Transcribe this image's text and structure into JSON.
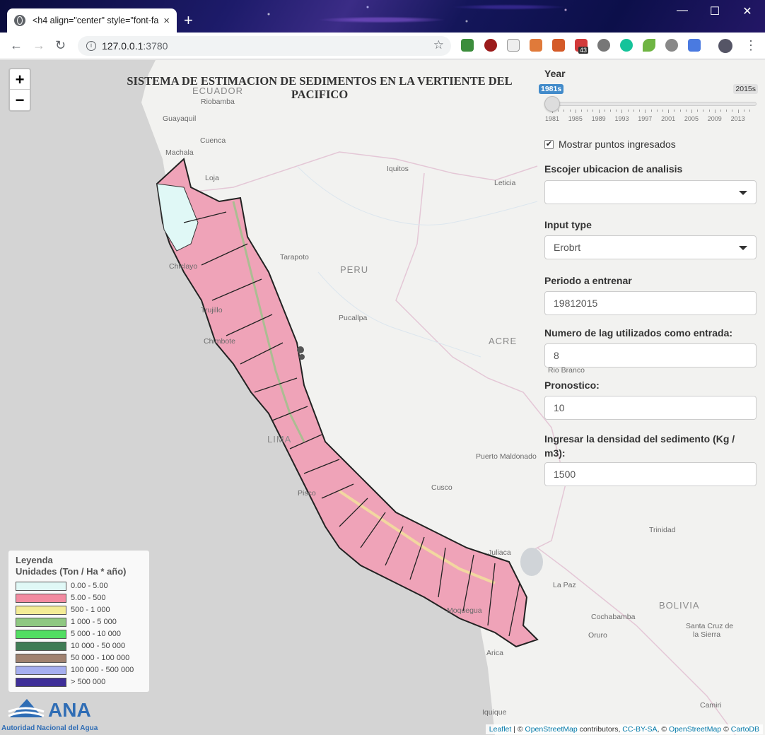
{
  "browser": {
    "tab_title": "<h4 align=\"center\" style=\"font-fa",
    "tab_close": "×",
    "new_tab": "+",
    "url_host": "127.0.0.1",
    "url_port": ":3780",
    "ext_badge": "43",
    "window": {
      "minimize": "—",
      "maximize": "☐",
      "close": "✕"
    }
  },
  "map": {
    "title_line1": "SISTEMA DE ESTIMACION DE SEDIMENTOS EN LA VERTIENTE DEL",
    "title_line2": "PACIFICO",
    "zoom_in": "+",
    "zoom_out": "−",
    "places": [
      {
        "name": "ECUADOR",
        "kind": "country"
      },
      {
        "name": "Riobamba",
        "kind": "city"
      },
      {
        "name": "Guayaquil",
        "kind": "city"
      },
      {
        "name": "Cuenca",
        "kind": "city"
      },
      {
        "name": "Machala",
        "kind": "city"
      },
      {
        "name": "Loja",
        "kind": "city"
      },
      {
        "name": "Iquitos",
        "kind": "city"
      },
      {
        "name": "Leticia",
        "kind": "city"
      },
      {
        "name": "Tarapoto",
        "kind": "city"
      },
      {
        "name": "PERU",
        "kind": "country"
      },
      {
        "name": "Chiclayo",
        "kind": "city"
      },
      {
        "name": "Trujillo",
        "kind": "city"
      },
      {
        "name": "Chimbote",
        "kind": "city"
      },
      {
        "name": "Pucallpa",
        "kind": "city"
      },
      {
        "name": "ACRE",
        "kind": "country"
      },
      {
        "name": "Rio Branco",
        "kind": "city"
      },
      {
        "name": "LIMA",
        "kind": "country"
      },
      {
        "name": "Puerto Maldonado",
        "kind": "city"
      },
      {
        "name": "Cusco",
        "kind": "city"
      },
      {
        "name": "Pisco",
        "kind": "city"
      },
      {
        "name": "Trinidad",
        "kind": "city"
      },
      {
        "name": "Juliaca",
        "kind": "city"
      },
      {
        "name": "La Paz",
        "kind": "city"
      },
      {
        "name": "BOLIVIA",
        "kind": "country"
      },
      {
        "name": "Cochabamba",
        "kind": "city"
      },
      {
        "name": "Santa Cruz de",
        "kind": "city"
      },
      {
        "name": "la Sierra",
        "kind": "city"
      },
      {
        "name": "Oruro",
        "kind": "city"
      },
      {
        "name": "Moquegua",
        "kind": "city"
      },
      {
        "name": "Arica",
        "kind": "city"
      },
      {
        "name": "Iquique",
        "kind": "city"
      },
      {
        "name": "Camiri",
        "kind": "city"
      }
    ]
  },
  "legend": {
    "title": "Leyenda",
    "subtitle": "Unidades (Ton / Ha * año)",
    "items": [
      {
        "label": "0.00 - 5.00",
        "color": "#e0f8f6"
      },
      {
        "label": "5.00 - 500",
        "color": "#f28aa0"
      },
      {
        "label": "500 - 1 000",
        "color": "#f4ec96"
      },
      {
        "label": "1 000 - 5 000",
        "color": "#8fc882"
      },
      {
        "label": "5 000 - 10 000",
        "color": "#52de62"
      },
      {
        "label": "10 000 - 50 000",
        "color": "#3f7c55"
      },
      {
        "label": "50 000 - 100 000",
        "color": "#a08270"
      },
      {
        "label": "100 000 - 500 000",
        "color": "#a6aff0"
      },
      {
        "label": "> 500 000",
        "color": "#3e2e98"
      }
    ]
  },
  "logo": {
    "acronym": "ANA",
    "name": "Autoridad Nacional del Agua",
    "color": "#2f6db5"
  },
  "panel": {
    "year_label": "Year",
    "slider": {
      "min_badge": "1981s",
      "max_badge": "2015s",
      "value_fraction": 0,
      "tick_labels": [
        "1981",
        "1985",
        "1989",
        "1993",
        "1997",
        "2001",
        "2005",
        "2009",
        "2013"
      ]
    },
    "checkbox_label": "Mostrar puntos ingresados",
    "checkbox_checked": true,
    "location_label": "Escojer ubicacion de analisis",
    "location_value": "",
    "input_type_label": "Input type",
    "input_type_value": "Erobrt",
    "period_label": "Periodo a entrenar",
    "period_value": "19812015",
    "lag_label": "Numero de lag utilizados como entrada:",
    "lag_value": "8",
    "forecast_label": "Pronostico:",
    "forecast_value": "10",
    "density_label": "Ingresar la densidad del sedimento (Kg / m3):",
    "density_value": "1500"
  },
  "attribution": {
    "leaflet": "Leaflet",
    "sep1": " | © ",
    "osm": "OpenStreetMap",
    "contrib": " contributors, ",
    "ccbysa": "CC-BY-SA",
    "sep2": ", © ",
    "osm2": "OpenStreetMap",
    "sep3": " © ",
    "carto": "CartoDB"
  }
}
